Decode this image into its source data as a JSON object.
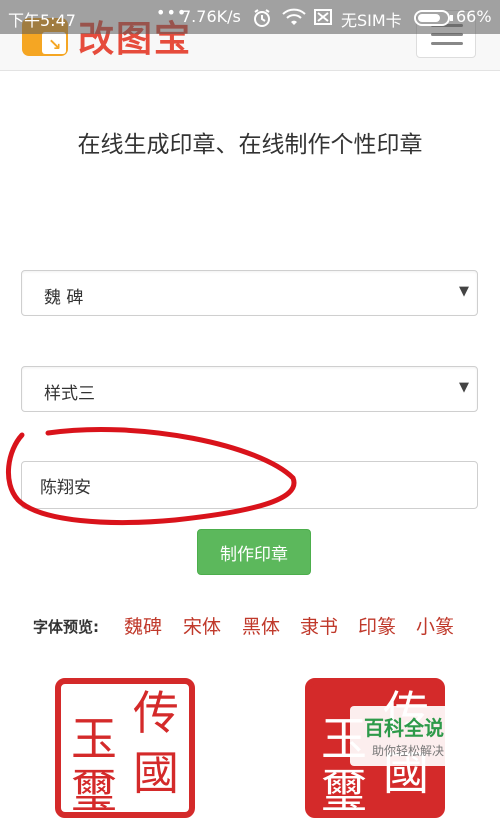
{
  "status_bar": {
    "time": "下午5:47",
    "dots": "•••",
    "speed": "7.76K/s",
    "sim": "无SIM卡",
    "battery": "66%"
  },
  "header": {
    "logo_text": "改图宝",
    "menu_icon": "hamburger-icon"
  },
  "page_title": "在线生成印章、在线制作个性印章",
  "form": {
    "font_select_value": "魏 碑",
    "style_select_value": "样式三",
    "name_value": "陈翔安",
    "submit_label": "制作印章"
  },
  "font_preview": {
    "label": "字体预览:",
    "samples": [
      "魏碑",
      "宋体",
      "黑体",
      "隶书",
      "印篆",
      "小篆"
    ]
  },
  "stamps": {
    "left_chars": [
      "传",
      "玉",
      "國",
      "璽"
    ],
    "right_chars": [
      "传",
      "玉",
      "國",
      "璽"
    ]
  },
  "watermark": {
    "main": "百科全说",
    "sub": "助你轻松解决"
  },
  "colors": {
    "button_green": "#5cb85c",
    "stamp_red": "#d42a2a",
    "annotation_red": "#d9131b",
    "logo_orange": "#f5a623",
    "logo_red": "#e64c3c"
  }
}
